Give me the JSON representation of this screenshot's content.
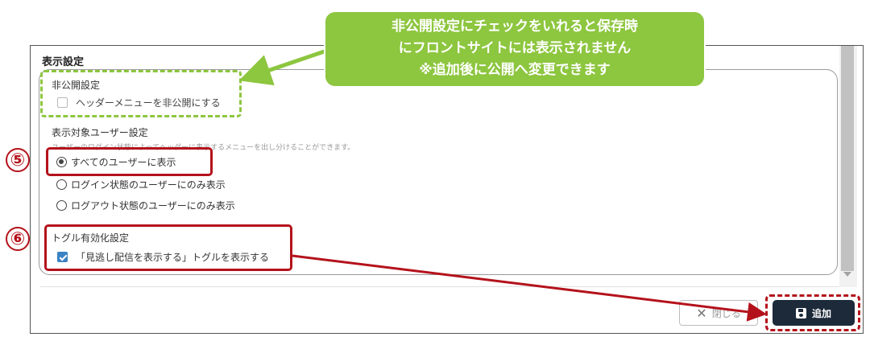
{
  "dialog": {
    "section_title": "表示設定",
    "hidden_setting": {
      "label": "非公開設定",
      "checkbox_label": "ヘッダーメニューを非公開にする",
      "checked": false
    },
    "target_user_setting": {
      "label": "表示対象ユーザー設定",
      "description": "ユーザーのログイン状態によってヘッダーに表示するメニューを出し分けることができます。",
      "options": [
        {
          "label": "すべてのユーザーに表示",
          "selected": true
        },
        {
          "label": "ログイン状態のユーザーにのみ表示",
          "selected": false
        },
        {
          "label": "ログアウト状態のユーザーにのみ表示",
          "selected": false
        }
      ]
    },
    "toggle_setting": {
      "label": "トグル有効化設定",
      "checkbox_label": "「見逃し配信を表示する」トグルを表示する",
      "checked": true
    },
    "footer": {
      "close_label": "閉じる",
      "add_label": "追加"
    }
  },
  "annotations": {
    "callout_lines": [
      "非公開設定にチェックをいれると保存時",
      "にフロントサイトには表示されません",
      "※追加後に公開へ変更できます"
    ],
    "marker_5": "⑤",
    "marker_6": "⑥",
    "colors": {
      "red": "#b4121b",
      "green": "#8dc63f",
      "primary_button": "#1c2a3a",
      "checkbox_checked": "#3b82c4"
    }
  }
}
